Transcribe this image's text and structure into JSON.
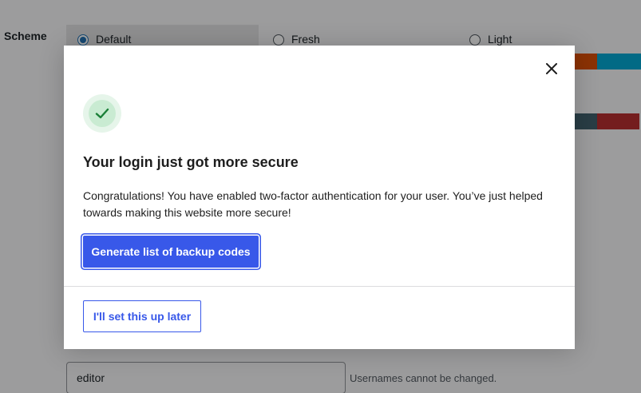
{
  "background": {
    "color_scheme_label": "Scheme",
    "scheme_options": [
      {
        "label": "Default",
        "selected": true
      },
      {
        "label": "Fresh",
        "selected": false
      },
      {
        "label": "Light",
        "selected": false
      }
    ],
    "swatch_colors": [
      "#d64e07",
      "#04a4cc",
      "#3f5f6b",
      "#b32d2e"
    ],
    "username_value": "editor",
    "username_note": "Usernames cannot be changed."
  },
  "modal": {
    "close_icon": "close-icon",
    "success_icon": "checkmark-icon",
    "title": "Your login just got more secure",
    "body": "Congratulations! You have enabled two-factor authentication for your user. You’ve just helped towards making this website more secure!",
    "primary_button_label": "Generate list of backup codes",
    "secondary_button_label": "I'll set this up later",
    "colors": {
      "accent": "#3858e9",
      "success": "#1a7f37"
    }
  }
}
